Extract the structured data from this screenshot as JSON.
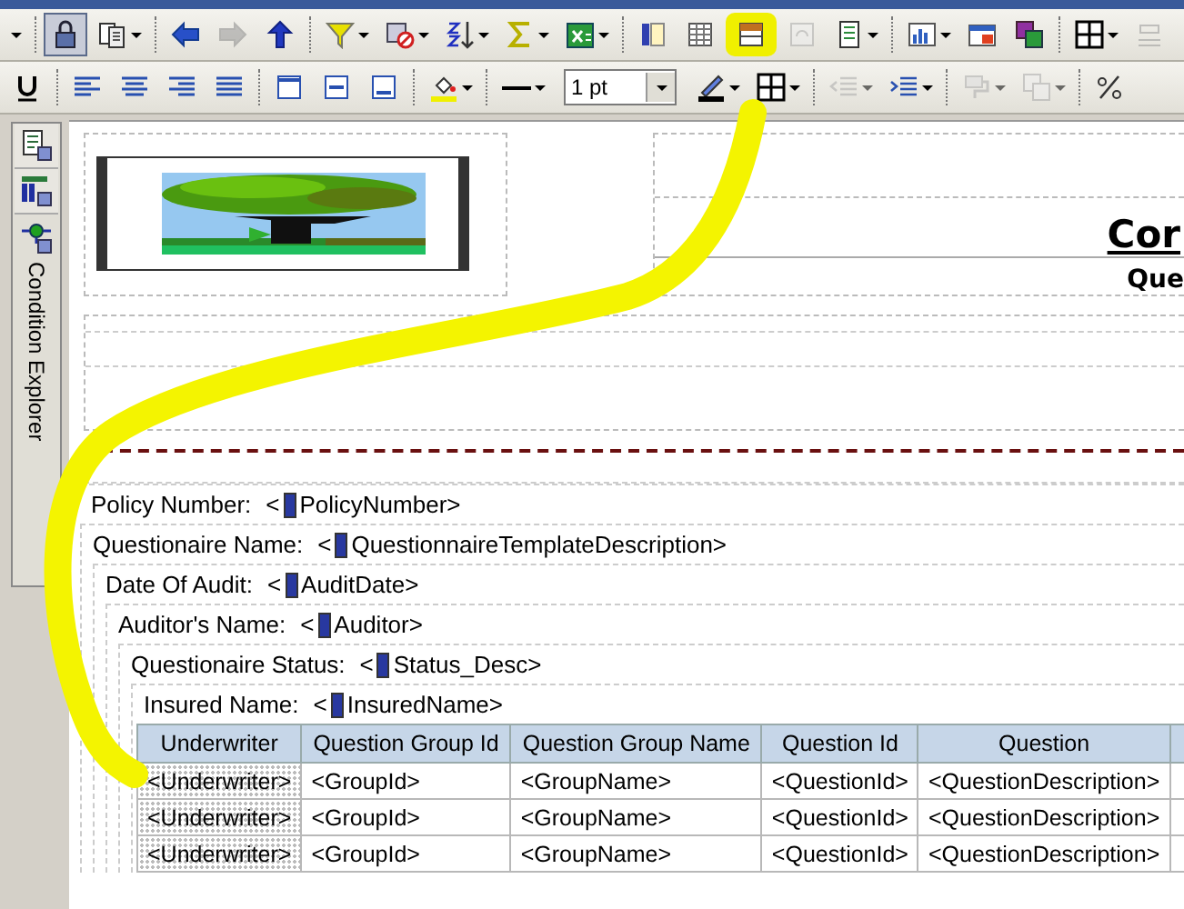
{
  "toolbars": [
    {
      "items": [
        {
          "kind": "menu",
          "disabled": false,
          "pressed": false,
          "highlighted": false
        },
        {
          "kind": "separator"
        },
        {
          "kind": "button",
          "dropdown": false,
          "disabled": false,
          "pressed": true,
          "highlighted": false
        },
        {
          "kind": "button",
          "dropdown": true,
          "disabled": false,
          "pressed": false,
          "highlighted": false
        },
        {
          "kind": "separator"
        },
        {
          "kind": "button",
          "dropdown": false,
          "disabled": false,
          "pressed": false,
          "highlighted": false
        },
        {
          "kind": "button",
          "dropdown": false,
          "disabled": true,
          "pressed": false,
          "highlighted": false
        },
        {
          "kind": "button",
          "dropdown": false,
          "disabled": false,
          "pressed": false,
          "highlighted": false
        },
        {
          "kind": "separator"
        },
        {
          "kind": "button",
          "dropdown": true,
          "disabled": false,
          "pressed": false,
          "highlighted": false
        },
        {
          "kind": "button",
          "dropdown": true,
          "disabled": false,
          "pressed": false,
          "highlighted": false
        },
        {
          "kind": "button",
          "dropdown": true,
          "disabled": false,
          "pressed": false,
          "highlighted": false
        },
        {
          "kind": "button",
          "dropdown": true,
          "disabled": false,
          "pressed": false,
          "highlighted": false
        },
        {
          "kind": "button",
          "dropdown": true,
          "disabled": false,
          "pressed": false,
          "highlighted": false
        },
        {
          "kind": "separator"
        },
        {
          "kind": "button",
          "dropdown": false,
          "disabled": false,
          "pressed": false,
          "highlighted": false
        },
        {
          "kind": "button",
          "dropdown": false,
          "disabled": false,
          "pressed": false,
          "highlighted": false
        },
        {
          "kind": "button",
          "dropdown": false,
          "disabled": false,
          "pressed": false,
          "highlighted": true
        },
        {
          "kind": "button",
          "dropdown": false,
          "disabled": true,
          "pressed": false,
          "highlighted": false
        },
        {
          "kind": "button",
          "dropdown": true,
          "disabled": false,
          "pressed": false,
          "highlighted": false
        },
        {
          "kind": "separator"
        },
        {
          "kind": "button",
          "dropdown": true,
          "disabled": false,
          "pressed": false,
          "highlighted": false
        },
        {
          "kind": "button",
          "dropdown": false,
          "disabled": false,
          "pressed": false,
          "highlighted": false
        },
        {
          "kind": "button",
          "dropdown": false,
          "disabled": false,
          "pressed": false,
          "highlighted": false
        },
        {
          "kind": "separator"
        },
        {
          "kind": "button",
          "dropdown": true,
          "disabled": false,
          "pressed": false,
          "highlighted": false
        },
        {
          "kind": "button",
          "dropdown": false,
          "disabled": true,
          "pressed": false,
          "highlighted": false
        }
      ]
    },
    {
      "items": [
        {
          "kind": "button",
          "dropdown": false,
          "disabled": false,
          "pressed": false,
          "highlighted": false
        },
        {
          "kind": "separator"
        },
        {
          "kind": "button",
          "dropdown": false,
          "disabled": false,
          "pressed": false,
          "highlighted": false
        },
        {
          "kind": "button",
          "dropdown": false,
          "disabled": false,
          "pressed": false,
          "highlighted": false
        },
        {
          "kind": "button",
          "dropdown": false,
          "disabled": false,
          "pressed": false,
          "highlighted": false
        },
        {
          "kind": "button",
          "dropdown": false,
          "disabled": false,
          "pressed": false,
          "highlighted": false
        },
        {
          "kind": "separator"
        },
        {
          "kind": "button",
          "dropdown": false,
          "disabled": false,
          "pressed": false,
          "highlighted": false
        },
        {
          "kind": "button",
          "dropdown": false,
          "disabled": false,
          "pressed": false,
          "highlighted": false
        },
        {
          "kind": "button",
          "dropdown": false,
          "disabled": false,
          "pressed": false,
          "highlighted": false
        },
        {
          "kind": "separator"
        },
        {
          "kind": "button",
          "dropdown": true,
          "disabled": false,
          "pressed": false,
          "highlighted": false
        },
        {
          "kind": "separator"
        },
        {
          "kind": "button",
          "dropdown": true,
          "disabled": false,
          "pressed": false,
          "highlighted": false
        },
        {
          "kind": "select",
          "value": "1 pt"
        },
        {
          "kind": "button",
          "dropdown": true,
          "disabled": false,
          "pressed": false,
          "highlighted": false
        },
        {
          "kind": "button",
          "dropdown": true,
          "disabled": false,
          "pressed": false,
          "highlighted": false
        },
        {
          "kind": "separator"
        },
        {
          "kind": "button",
          "dropdown": true,
          "disabled": true,
          "pressed": false,
          "highlighted": false
        },
        {
          "kind": "button",
          "dropdown": true,
          "disabled": false,
          "pressed": false,
          "highlighted": false
        },
        {
          "kind": "separator"
        },
        {
          "kind": "button",
          "dropdown": true,
          "disabled": true,
          "pressed": false,
          "highlighted": false
        },
        {
          "kind": "button",
          "dropdown": true,
          "disabled": true,
          "pressed": false,
          "highlighted": false
        },
        {
          "kind": "separator"
        },
        {
          "kind": "button",
          "dropdown": false,
          "disabled": false,
          "pressed": false,
          "highlighted": false
        }
      ]
    }
  ],
  "side_panel": {
    "buttons": [
      {
        "selected": false
      },
      {
        "selected": false
      }
    ],
    "tab_label": "Condition Explorer"
  },
  "report": {
    "title": "Cor",
    "subtitle": "Que",
    "fields": [
      {
        "label": "Policy Number:",
        "field_prefix": "<",
        "field": "PolicyNumber>"
      },
      {
        "label": "Questionaire Name:",
        "field_prefix": "<",
        "field": "QuestionnaireTemplateDescription>",
        "children": [
          {
            "label": "Date Of Audit:",
            "field_prefix": "<",
            "field": "AuditDate>",
            "children": [
              {
                "label": "Auditor's Name:",
                "field_prefix": "<",
                "field": "Auditor>",
                "children": [
                  {
                    "label": "Questionaire Status:",
                    "field_prefix": "<",
                    "field": "Status_Desc>",
                    "children": [
                      {
                        "label": "Insured Name:",
                        "field_prefix": "<",
                        "field": "InsuredName>"
                      }
                    ]
                  }
                ]
              }
            ]
          }
        ]
      }
    ],
    "table": {
      "columns": [
        "Underwriter",
        "Question Group Id",
        "Question Group Name",
        "Question Id",
        "Question"
      ],
      "rows": [
        [
          "<Underwriter>",
          "<GroupId>",
          "<GroupName>",
          "<QuestionId>",
          "<QuestionDescription>"
        ],
        [
          "<Underwriter>",
          "<GroupId>",
          "<GroupName>",
          "<QuestionId>",
          "<QuestionDescription>"
        ],
        [
          "<Underwriter>",
          "<GroupId>",
          "<GroupName>",
          "<QuestionId>",
          "<QuestionDescription>"
        ]
      ]
    }
  }
}
